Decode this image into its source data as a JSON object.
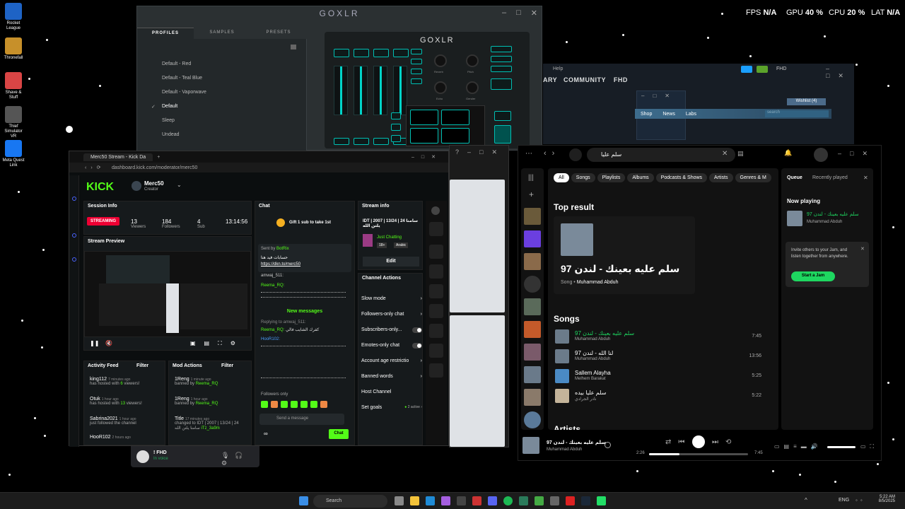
{
  "desktop": {
    "icons": [
      {
        "label": "Rocket League",
        "icon": "rocket-league-icon",
        "color": "#1e63c5"
      },
      {
        "label": "Thronefall",
        "icon": "thronefall-icon",
        "color": "#c7902a"
      },
      {
        "label": "Shave & Stuff",
        "icon": "shave-stuff-icon",
        "color": "#d94545"
      },
      {
        "label": "Thief Simulator VR",
        "icon": "thief-simulator-icon",
        "color": "#555555"
      },
      {
        "label": "Meta Quest Link",
        "icon": "meta-quest-icon",
        "color": "#1877f2"
      }
    ]
  },
  "overlay": {
    "fps_label": "FPS",
    "fps_value": "N/A",
    "gpu_label": "GPU",
    "gpu_value": "40 %",
    "cpu_label": "CPU",
    "cpu_value": "20 %",
    "lat_label": "LAT",
    "lat_value": "N/A"
  },
  "goxlr": {
    "title": "GOXLR",
    "tabs": [
      "PROFILES",
      "SAMPLES",
      "PRESETS"
    ],
    "profiles": [
      "Default - Red",
      "Default - Teal Blue",
      "Default - Vaporwave",
      "Default",
      "Sleep",
      "Undead"
    ],
    "checked_profile": "Default",
    "device_logo": "GOXLR",
    "knob_labels": [
      "Reverb",
      "Pitch",
      "Echo",
      "Gender"
    ],
    "accent": "#00d4c8"
  },
  "kick": {
    "tab_title": "Merc50 Stream - Kick Da",
    "url": "dashboard.kick.com/moderator/merc50",
    "logo": "KICK",
    "channel_name": "Merc50",
    "channel_role": "Creator",
    "session": {
      "title": "Session Info",
      "status": "STREAMING",
      "viewers": "13",
      "viewers_label": "Viewers",
      "followers": "184",
      "followers_label": "Followers",
      "subs": "4",
      "subs_label": "Sub",
      "duration": "13:14:56"
    },
    "preview_title": "Stream Preview",
    "chat": {
      "title": "Chat",
      "gift_text": "Gift 1 sub to take 1st",
      "pinned_by_label": "Sent by",
      "pinned_by": "BotRix",
      "pinned_text": "حسابات فيد هنا",
      "pinned_link": "https://dkn.to/merc50",
      "messages": [
        {
          "user": "amwaj_511:",
          "text": ""
        },
        {
          "user": "Reema_RQ:",
          "text": ""
        }
      ],
      "new_messages": "New messages",
      "replying": "Replying to amwaj_511:",
      "reply_user": "Reema_RQ:",
      "reply_text": "كفرك الشايب فالي",
      "user3": "HooR102:",
      "followers_only": "Followers only",
      "placeholder": "Send a message",
      "send": "Chat",
      "points": "∞"
    },
    "stream_info": {
      "title": "Stream info",
      "stream_title": "IDT | 2007 | 13/24 | 24 سامنا يلتن الله",
      "category": "Just Chatting",
      "tags": [
        "18+",
        "Arabic"
      ],
      "edit": "Edit"
    },
    "channel_actions": {
      "title": "Channel Actions",
      "items": [
        {
          "label": "Slow mode",
          "type": "arrow"
        },
        {
          "label": "Followers-only chat",
          "type": "arrow"
        },
        {
          "label": "Subscribers-only...",
          "type": "toggle"
        },
        {
          "label": "Emotes-only chat",
          "type": "toggle"
        },
        {
          "label": "Account age restrictio",
          "type": "arrow"
        },
        {
          "label": "Banned words",
          "type": "arrow"
        },
        {
          "label": "Host Channel",
          "type": "none"
        },
        {
          "label": "Set goals",
          "type": "active",
          "extra": "2 active"
        }
      ]
    },
    "activity": {
      "title": "Activity Feed",
      "filter": "Filter",
      "rows": [
        {
          "user": "king112",
          "time": "7 minutes ago",
          "pre": "has hosted with",
          "n": "6",
          "post": "viewers!"
        },
        {
          "user": "Otuk",
          "time": "1 hour ago",
          "pre": "has hosted with",
          "n": "13",
          "post": "viewers!"
        },
        {
          "user": "Sabrina2021",
          "time": "1 hour ago",
          "pre": "just followed the channel",
          "n": "",
          "post": ""
        },
        {
          "user": "HooR102",
          "time": "2 hours ago",
          "pre": "",
          "n": "",
          "post": ""
        }
      ]
    },
    "mod": {
      "title": "Mod Actions",
      "filter": "Filter",
      "rows": [
        {
          "user": "1Reng",
          "time": "1 minute ago",
          "action": "banned by",
          "by": "Reema_RQ"
        },
        {
          "user": "1Reng",
          "time": "1 hour ago",
          "action": "banned by",
          "by": "Reema_RQ"
        },
        {
          "user": "Title",
          "time": "17 minutes ago",
          "action": "changed to IDT | 2007 | 13/24 | 24 سامنا يلتن الله",
          "by": "iTz_3a9m"
        }
      ]
    }
  },
  "discord": {
    "user": "! FHD",
    "status": "In voice"
  },
  "steam": {
    "menu_help": "Help",
    "nav": [
      "ARY",
      "COMMUNITY",
      "FHD"
    ],
    "store_nav": [
      "Shop",
      "News",
      "Labs"
    ],
    "wishlist": "Wishlist (4)",
    "search_placeholder": "search",
    "account": "FHD"
  },
  "spotify": {
    "search_value": "سلم عليا",
    "filters": [
      "All",
      "Songs",
      "Playlists",
      "Albums",
      "Podcasts & Shows",
      "Artists",
      "Genres & M"
    ],
    "top_result_title": "Top result",
    "top_song": "97 سلم عليه بعينك - لندن",
    "top_meta_type": "Song",
    "top_artist": "Muhammad Abduh",
    "songs_title": "Songs",
    "songs": [
      {
        "title": "97 سلم عليه بعينك - لندن",
        "artist": "Muhammad Abduh",
        "duration": "7:45",
        "playing": true
      },
      {
        "title": "97 لنا الله - لندن",
        "artist": "Muhammad Abduh",
        "duration": "13:56",
        "playing": false
      },
      {
        "title": "Sallem Alayha",
        "artist": "Melhem Barakat",
        "duration": "5:25",
        "playing": false
      },
      {
        "title": "سلم عليا بيده",
        "artist": "نادر الجرادي",
        "duration": "5:22",
        "playing": false
      }
    ],
    "artists_title": "Artists",
    "queue_tab": "Queue",
    "recent_tab": "Recently played",
    "now_playing_label": "Now playing",
    "now_title": "سلم عليه بعينك - لندن 97",
    "now_artist": "Muhammad Abduh",
    "jam_text": "Invite others to your Jam, and listen together from anywhere.",
    "jam_button": "Start a Jam",
    "player": {
      "title": "97 سلم عليه بعينك - لندن",
      "artist": "Muhammad Abduh",
      "elapsed": "2:26",
      "total": "7:45",
      "progress": 0.31
    },
    "accent": "#1ed760"
  },
  "taskbar": {
    "search": "Search",
    "lang": "ENG",
    "time": "5:22 AM",
    "date": "8/5/2025"
  }
}
